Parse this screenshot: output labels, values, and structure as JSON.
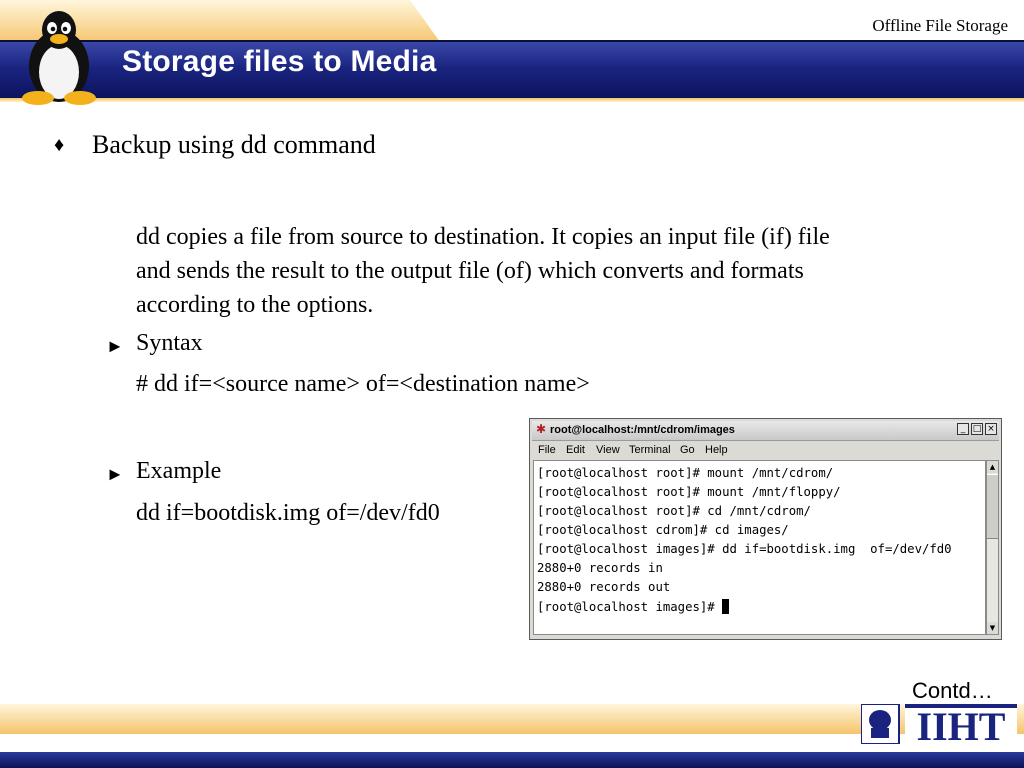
{
  "header": {
    "top_label": "Offline File Storage",
    "title": "Storage files to Media"
  },
  "content": {
    "bullet_symbol": "♦",
    "bullet": "Backup using dd command",
    "description_lines": [
      "dd copies a file from source to destination. It copies an  input file (if) file",
      "and sends the result to the output file (of)  which converts and formats",
      "according to the options."
    ],
    "sub_arrow": "►",
    "syntax_label": "Syntax",
    "syntax_text": "# dd  if=<source name> of=<destination name>",
    "example_label": "Example",
    "example_text": "dd if=bootdisk.img of=/dev/fd0"
  },
  "terminal": {
    "title": "root@localhost:/mnt/cdrom/images",
    "menu": [
      "File",
      "Edit",
      "View",
      "Terminal",
      "Go",
      "Help"
    ],
    "lines": [
      "[root@localhost root]# mount /mnt/cdrom/",
      "[root@localhost root]# mount /mnt/floppy/",
      "[root@localhost root]# cd /mnt/cdrom/",
      "[root@localhost cdrom]# cd images/",
      "[root@localhost images]# dd if=bootdisk.img  of=/dev/fd0",
      "2880+0 records in",
      "2880+0 records out",
      "[root@localhost images]# "
    ]
  },
  "footer": {
    "contd": "Contd…",
    "logo_text": "IIHT"
  },
  "colors": {
    "band_blue": "#1a2480",
    "gold": "#f6c670"
  }
}
